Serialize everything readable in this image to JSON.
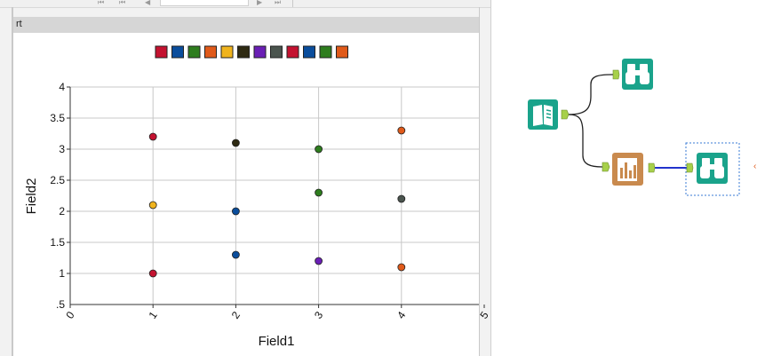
{
  "window": {
    "title_fragment": "rt"
  },
  "toolbar": {
    "first_page_icon": "first-page-icon",
    "prev_page_icon": "prev-page-icon",
    "next_page_icon": "next-page-icon",
    "last_page_icon": "last-page-icon"
  },
  "chart_data": {
    "type": "scatter",
    "xlabel": "Field1",
    "ylabel": "Field2",
    "xlim": [
      0,
      5
    ],
    "ylim": [
      0.5,
      4
    ],
    "x_ticks": [
      "0",
      "1",
      "2",
      "3",
      "4",
      "5"
    ],
    "y_ticks": [
      "1",
      "1.5",
      "2",
      "2.5",
      "3",
      "3.5",
      "4"
    ],
    "y_bottom_label": ".5",
    "grid": true,
    "legend_position": "top",
    "legend_colors": [
      "#c41230",
      "#0a4d9c",
      "#2e7d1e",
      "#e05a1a",
      "#f0b41e",
      "#2e2a12",
      "#6a1fb5",
      "#4a544e",
      "#c41230",
      "#0a4d9c",
      "#2e7d1e",
      "#e05a1a"
    ],
    "points": [
      {
        "x": 1,
        "y": 3.2,
        "color": "#c41230"
      },
      {
        "x": 1,
        "y": 2.1,
        "color": "#f0b41e"
      },
      {
        "x": 1,
        "y": 1.0,
        "color": "#c41230"
      },
      {
        "x": 2,
        "y": 3.1,
        "color": "#2e2a12"
      },
      {
        "x": 2,
        "y": 2.0,
        "color": "#0a4d9c"
      },
      {
        "x": 2,
        "y": 1.3,
        "color": "#0a4d9c"
      },
      {
        "x": 3,
        "y": 3.0,
        "color": "#2e7d1e"
      },
      {
        "x": 3,
        "y": 2.3,
        "color": "#2e7d1e"
      },
      {
        "x": 3,
        "y": 1.2,
        "color": "#6a1fb5"
      },
      {
        "x": 4,
        "y": 3.3,
        "color": "#e05a1a"
      },
      {
        "x": 4,
        "y": 2.2,
        "color": "#4a544e"
      },
      {
        "x": 4,
        "y": 1.1,
        "color": "#e05a1a"
      }
    ]
  },
  "workflow": {
    "nodes": [
      {
        "name": "input-data-tool",
        "icon": "book-icon",
        "color": "#1aa38b"
      },
      {
        "name": "browse-tool-top",
        "icon": "binoculars-icon",
        "color": "#1aa38b"
      },
      {
        "name": "scatter-chart-tool",
        "icon": "bar-chart-icon",
        "color": "#c98a4e"
      },
      {
        "name": "browse-tool-selected",
        "icon": "binoculars-icon",
        "color": "#1aa38b"
      }
    ],
    "selected_connection_color": "#2233cc"
  }
}
